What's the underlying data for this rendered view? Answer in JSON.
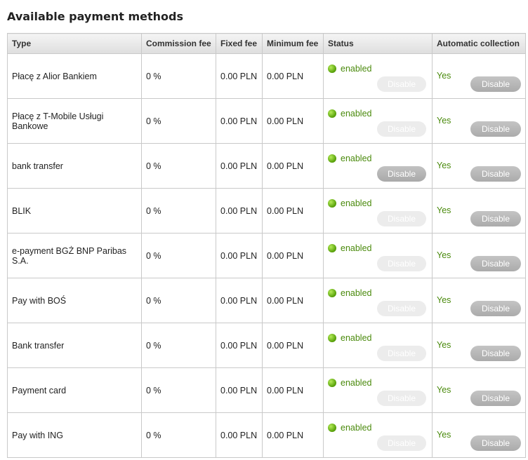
{
  "page": {
    "title": "Available payment methods"
  },
  "table": {
    "headers": [
      "Type",
      "Commission fee",
      "Fixed fee",
      "Minimum fee",
      "Status",
      "Automatic collection"
    ],
    "rows": [
      {
        "type": "Płacę z Alior Bankiem",
        "commission": "0 %",
        "fixed": "0.00 PLN",
        "minimum": "0.00 PLN",
        "status": "enabled",
        "status_button": "Disable",
        "status_button_active": false,
        "auto": "Yes",
        "auto_button": "Disable"
      },
      {
        "type": "Płacę z T-Mobile Usługi Bankowe",
        "commission": "0 %",
        "fixed": "0.00 PLN",
        "minimum": "0.00 PLN",
        "status": "enabled",
        "status_button": "Disable",
        "status_button_active": false,
        "auto": "Yes",
        "auto_button": "Disable"
      },
      {
        "type": "bank transfer",
        "commission": "0 %",
        "fixed": "0.00 PLN",
        "minimum": "0.00 PLN",
        "status": "enabled",
        "status_button": "Disable",
        "status_button_active": true,
        "auto": "Yes",
        "auto_button": "Disable"
      },
      {
        "type": "BLIK",
        "commission": "0 %",
        "fixed": "0.00 PLN",
        "minimum": "0.00 PLN",
        "status": "enabled",
        "status_button": "Disable",
        "status_button_active": false,
        "auto": "Yes",
        "auto_button": "Disable"
      },
      {
        "type": "e-payment BGŻ BNP Paribas S.A.",
        "commission": "0 %",
        "fixed": "0.00 PLN",
        "minimum": "0.00 PLN",
        "status": "enabled",
        "status_button": "Disable",
        "status_button_active": false,
        "auto": "Yes",
        "auto_button": "Disable"
      },
      {
        "type": "Pay with BOŚ",
        "commission": "0 %",
        "fixed": "0.00 PLN",
        "minimum": "0.00 PLN",
        "status": "enabled",
        "status_button": "Disable",
        "status_button_active": false,
        "auto": "Yes",
        "auto_button": "Disable"
      },
      {
        "type": "Bank transfer",
        "commission": "0 %",
        "fixed": "0.00 PLN",
        "minimum": "0.00 PLN",
        "status": "enabled",
        "status_button": "Disable",
        "status_button_active": false,
        "auto": "Yes",
        "auto_button": "Disable"
      },
      {
        "type": "Payment card",
        "commission": "0 %",
        "fixed": "0.00 PLN",
        "minimum": "0.00 PLN",
        "status": "enabled",
        "status_button": "Disable",
        "status_button_active": false,
        "auto": "Yes",
        "auto_button": "Disable"
      },
      {
        "type": "Pay with ING",
        "commission": "0 %",
        "fixed": "0.00 PLN",
        "minimum": "0.00 PLN",
        "status": "enabled",
        "status_button": "Disable",
        "status_button_active": false,
        "auto": "Yes",
        "auto_button": "Disable"
      }
    ]
  },
  "colors": {
    "enabled_text": "#4a8a0c",
    "enabled_dot": "#5aa30b",
    "button_active": "#b0b0b0",
    "button_faded": "#ececec",
    "header_bg": "#e6e6e6",
    "border": "#c9c9c9"
  },
  "icons": {
    "status_indicator": "green-dot-icon"
  }
}
